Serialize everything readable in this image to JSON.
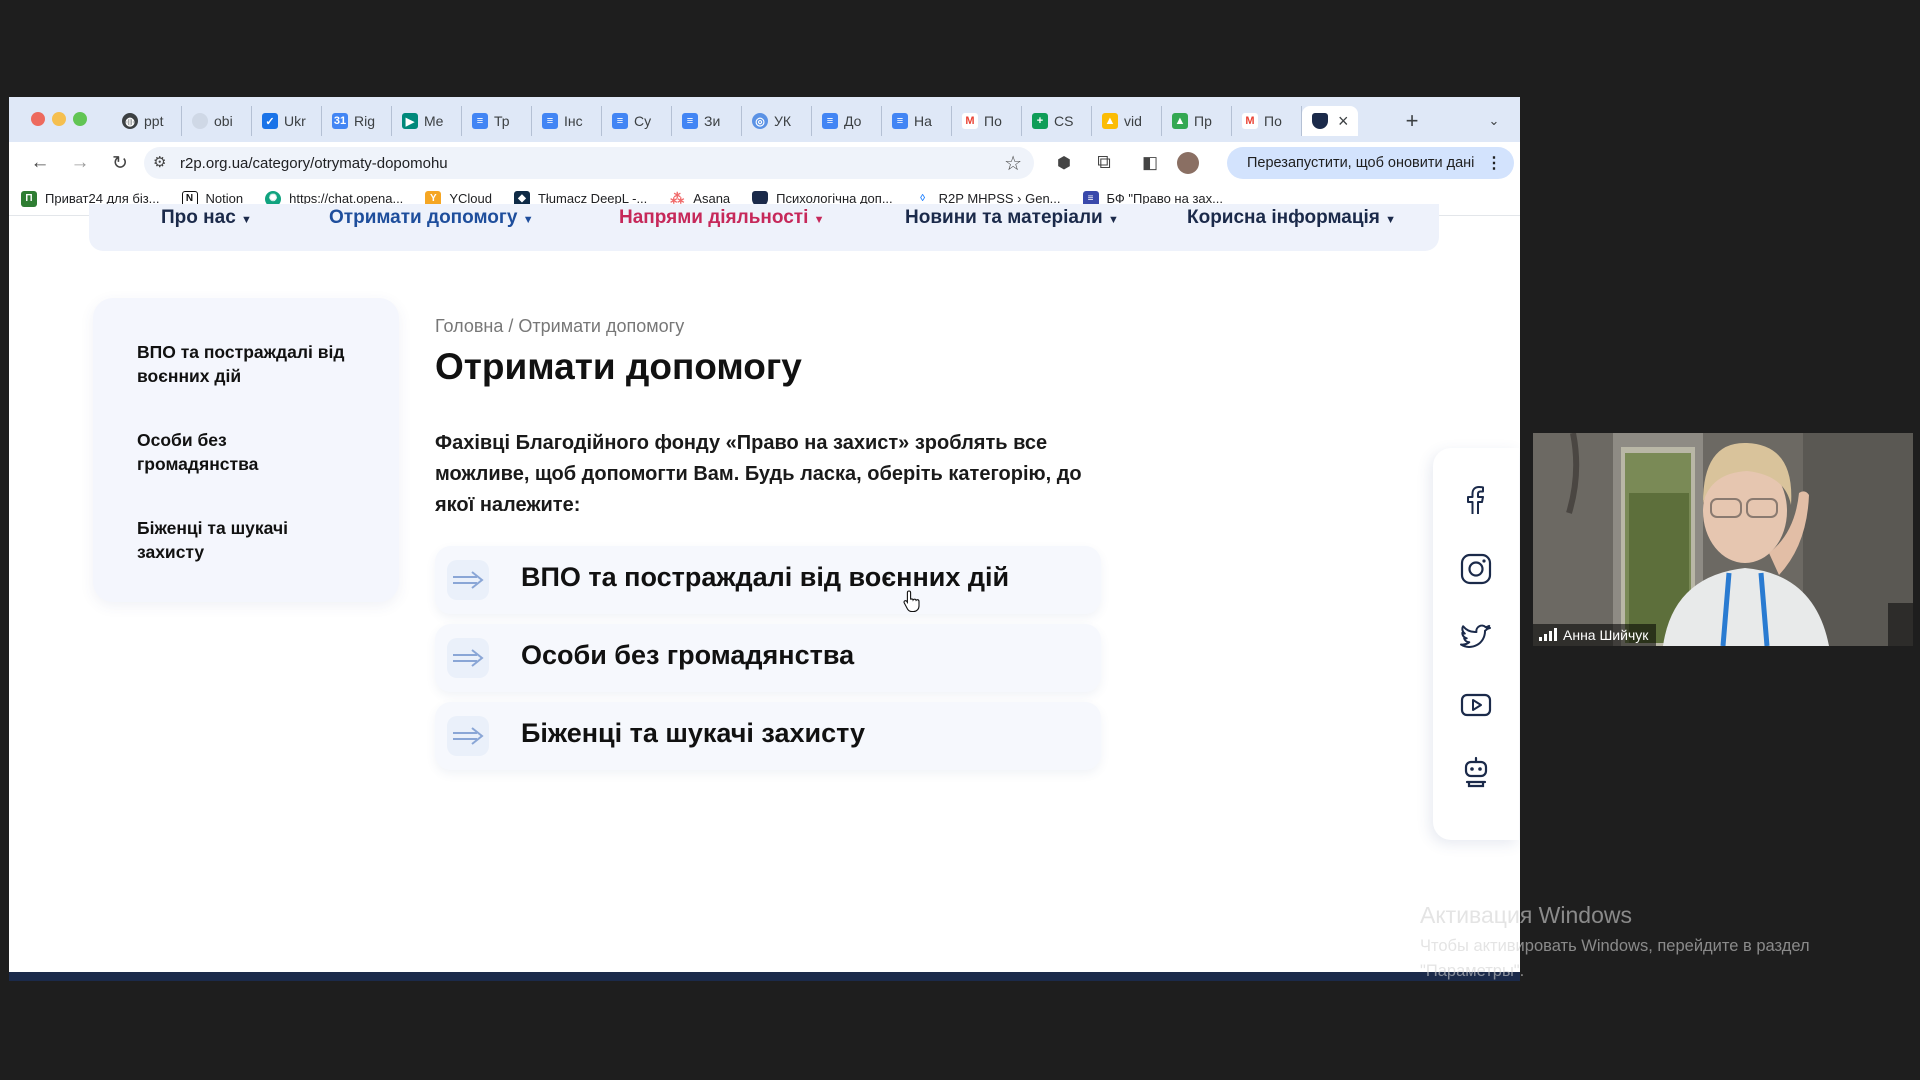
{
  "browser": {
    "tabs": [
      {
        "label": "ppt",
        "icon": "globe-icon",
        "color": "#3c4043"
      },
      {
        "label": "obi",
        "icon": "circle-icon",
        "color": "#cfd8e6"
      },
      {
        "label": "Ukr",
        "icon": "check-icon",
        "color": "#1a73e8"
      },
      {
        "label": "Rig",
        "icon": "calendar-icon",
        "color": "#4285f4"
      },
      {
        "label": "Me",
        "icon": "meet-icon",
        "color": "#00897b"
      },
      {
        "label": "Тр",
        "icon": "docs-icon",
        "color": "#4285f4"
      },
      {
        "label": "Інс",
        "icon": "docs-icon",
        "color": "#4285f4"
      },
      {
        "label": "Су",
        "icon": "docs-icon",
        "color": "#4285f4"
      },
      {
        "label": "Зи",
        "icon": "docs-icon",
        "color": "#4285f4"
      },
      {
        "label": "УК",
        "icon": "un-icon",
        "color": "#5b92e5"
      },
      {
        "label": "До",
        "icon": "docs-icon",
        "color": "#4285f4"
      },
      {
        "label": "На",
        "icon": "docs-icon",
        "color": "#4285f4"
      },
      {
        "label": "По",
        "icon": "gmail-icon",
        "color": "#ea4335"
      },
      {
        "label": "CS",
        "icon": "sheets-icon",
        "color": "#0f9d58"
      },
      {
        "label": "vid",
        "icon": "drive-icon",
        "color": "#fbbc04"
      },
      {
        "label": "Пр",
        "icon": "drive-icon",
        "color": "#34a853"
      },
      {
        "label": "По",
        "icon": "gmail-icon",
        "color": "#ea4335"
      }
    ],
    "active_tab_close": "×",
    "new_tab": "+",
    "tab_menu": "⌄",
    "url": "r2p.org.ua/category/otrymaty-dopomohu",
    "relaunch_label": "Перезапустити, щоб оновити дані",
    "bookmarks": [
      {
        "label": "Приват24 для біз...",
        "color": "#2e7d32"
      },
      {
        "label": "Notion",
        "color": "#111111"
      },
      {
        "label": "https://chat.opena...",
        "color": "#10a37f"
      },
      {
        "label": "YCloud",
        "color": "#f5a623"
      },
      {
        "label": "Tłumacz DeepL -...",
        "color": "#0f2b46"
      },
      {
        "label": "Asana",
        "color": "#f06a6a"
      },
      {
        "label": "Психологічна доп...",
        "color": "#1b2a4a"
      },
      {
        "label": "R2P MHPSS › Gen...",
        "color": "#2684ff"
      },
      {
        "label": "БФ \"Право на зах...",
        "color": "#3949ab"
      }
    ]
  },
  "site": {
    "nav": [
      {
        "label": "Про нас",
        "color": "#1b2a4a"
      },
      {
        "label": "Отримати допомогу",
        "color": "#1e4e9c"
      },
      {
        "label": "Напрями діяльності",
        "color": "#c6285a"
      },
      {
        "label": "Новини та матеріали",
        "color": "#1b2a4a"
      },
      {
        "label": "Корисна інформація",
        "color": "#1b2a4a"
      }
    ],
    "sidebar": [
      "ВПО та постраждалі від воєнних дій",
      "Особи без громадянства",
      "Біженці та шукачі захисту"
    ],
    "breadcrumb": "Головна / Отримати допомогу",
    "title": "Отримати допомогу",
    "intro": "Фахівці Благодійного фонду «Право на захист» зроблять все можливе, щоб допомогти Вам. Будь ласка, оберіть категорію, до якої належите:",
    "cards": [
      "ВПО та постраждалі від воєнних дій",
      "Особи без громадянства",
      "Біженці та шукачі захисту"
    ],
    "social": [
      "facebook-icon",
      "instagram-icon",
      "twitter-icon",
      "youtube-icon",
      "chatbot-icon"
    ]
  },
  "video": {
    "participant_name": "Анна Шийчук"
  },
  "watermark": {
    "title": "Активация Windows",
    "line": "Чтобы активировать Windows, перейдите в раздел \"Параметры\"."
  }
}
